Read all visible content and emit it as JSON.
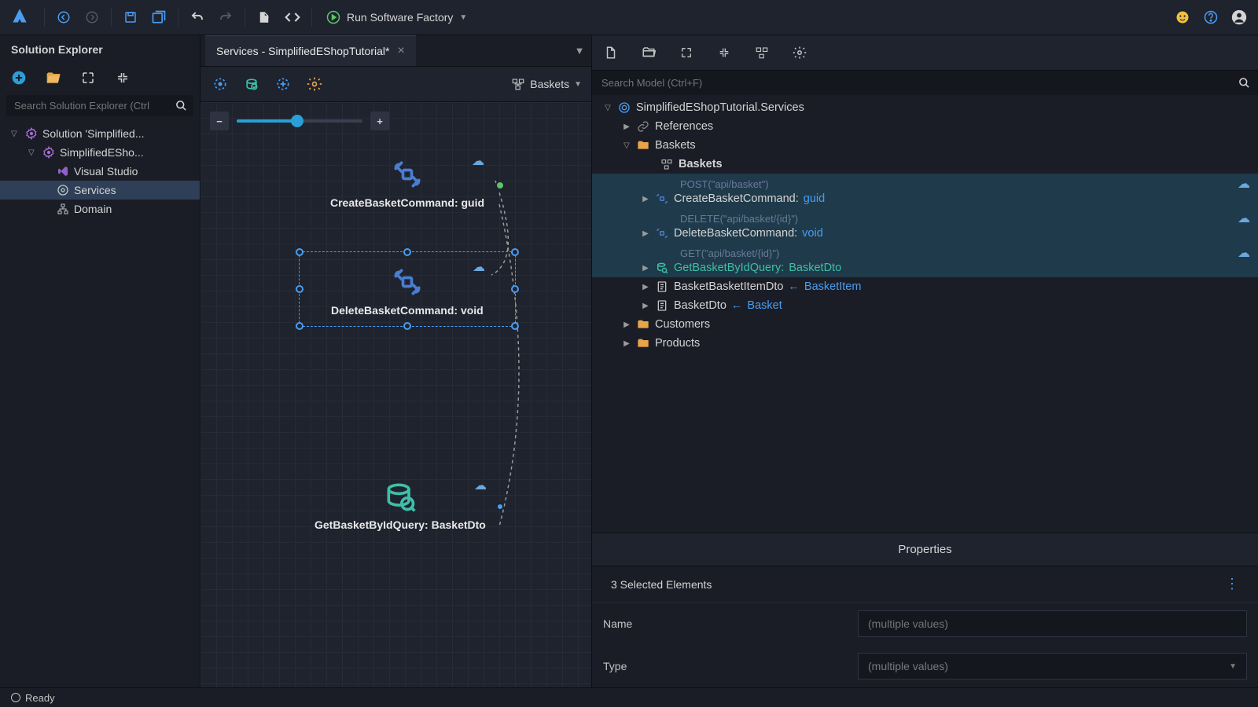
{
  "toolbar": {
    "run_label": "Run Software Factory"
  },
  "solution_explorer": {
    "title": "Solution Explorer",
    "search_placeholder": "Search Solution Explorer (Ctrl",
    "nodes": {
      "root": "Solution 'Simplified...",
      "project": "SimplifiedESho...",
      "vs": "Visual Studio",
      "services": "Services",
      "domain": "Domain"
    }
  },
  "tab": {
    "label": "Services - SimplifiedEShopTutorial*"
  },
  "designer": {
    "context": "Baskets",
    "nodes": {
      "create": "CreateBasketCommand: guid",
      "delete": "DeleteBasketCommand: void",
      "query": "GetBasketByIdQuery: BasketDto"
    }
  },
  "model": {
    "search_placeholder": "Search Model (Ctrl+F)",
    "root": "SimplifiedEShopTutorial.Services",
    "references": "References",
    "baskets": "Baskets",
    "baskets_diagram": "Baskets",
    "create_route": "POST(\"api/basket\")",
    "create_name": "CreateBasketCommand:",
    "create_type": "guid",
    "delete_route": "DELETE(\"api/basket/{id}\")",
    "delete_name": "DeleteBasketCommand:",
    "delete_type": "void",
    "get_route": "GET(\"api/basket/{id}\")",
    "get_name": "GetBasketByIdQuery:",
    "get_type": "BasketDto",
    "dto1": "BasketBasketItemDto",
    "dto1_link": "BasketItem",
    "dto2": "BasketDto",
    "dto2_link": "Basket",
    "customers": "Customers",
    "products": "Products"
  },
  "properties": {
    "title": "Properties",
    "subtitle": "3 Selected Elements",
    "name_label": "Name",
    "name_value": "(multiple values)",
    "type_label": "Type",
    "type_value": "(multiple values)"
  },
  "status": {
    "text": "Ready"
  }
}
